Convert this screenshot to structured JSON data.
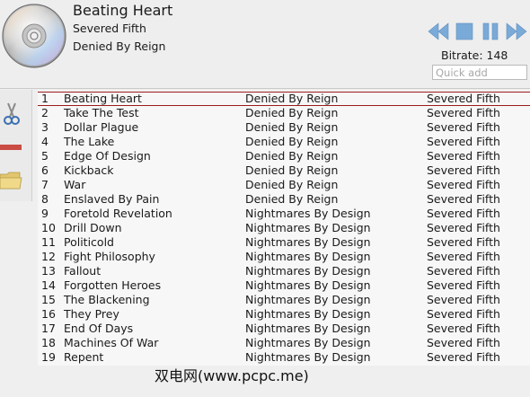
{
  "now_playing": {
    "title": "Beating Heart",
    "artist": "Severed Fifth",
    "album": "Denied By Reign"
  },
  "controls": {
    "prev_icon": "previous-track-icon",
    "stop_icon": "stop-icon",
    "pause_icon": "pause-icon",
    "next_icon": "next-track-icon",
    "icon_color": "#7aaad8"
  },
  "bitrate_text": "Bitrate: 148",
  "quick_add": {
    "placeholder": "Quick add",
    "value": ""
  },
  "side_tools": [
    "cut-icon",
    "remove-icon",
    "open-folder-icon"
  ],
  "playlist": {
    "selected_index": 0,
    "tracks": [
      {
        "num": "1",
        "title": "Beating Heart",
        "album": "Denied By Reign",
        "artist": "Severed Fifth"
      },
      {
        "num": "2",
        "title": "Take The Test",
        "album": "Denied By Reign",
        "artist": "Severed Fifth"
      },
      {
        "num": "3",
        "title": "Dollar Plague",
        "album": "Denied By Reign",
        "artist": "Severed Fifth"
      },
      {
        "num": "4",
        "title": "The Lake",
        "album": "Denied By Reign",
        "artist": "Severed Fifth"
      },
      {
        "num": "5",
        "title": "Edge Of Design",
        "album": "Denied By Reign",
        "artist": "Severed Fifth"
      },
      {
        "num": "6",
        "title": "Kickback",
        "album": "Denied By Reign",
        "artist": "Severed Fifth"
      },
      {
        "num": "7",
        "title": "War",
        "album": "Denied By Reign",
        "artist": "Severed Fifth"
      },
      {
        "num": "8",
        "title": "Enslaved By Pain",
        "album": "Denied By Reign",
        "artist": "Severed Fifth"
      },
      {
        "num": "9",
        "title": "Foretold Revelation",
        "album": "Nightmares By Design",
        "artist": "Severed Fifth"
      },
      {
        "num": "10",
        "title": "Drill Down",
        "album": "Nightmares By Design",
        "artist": "Severed Fifth"
      },
      {
        "num": "11",
        "title": "Politicold",
        "album": "Nightmares By Design",
        "artist": "Severed Fifth"
      },
      {
        "num": "12",
        "title": "Fight Philosophy",
        "album": "Nightmares By Design",
        "artist": "Severed Fifth"
      },
      {
        "num": "13",
        "title": "Fallout",
        "album": "Nightmares By Design",
        "artist": "Severed Fifth"
      },
      {
        "num": "14",
        "title": "Forgotten Heroes",
        "album": "Nightmares By Design",
        "artist": "Severed Fifth"
      },
      {
        "num": "15",
        "title": "The Blackening",
        "album": "Nightmares By Design",
        "artist": "Severed Fifth"
      },
      {
        "num": "16",
        "title": "They Prey",
        "album": "Nightmares By Design",
        "artist": "Severed Fifth"
      },
      {
        "num": "17",
        "title": "End Of Days",
        "album": "Nightmares By Design",
        "artist": "Severed Fifth"
      },
      {
        "num": "18",
        "title": "Machines Of War",
        "album": "Nightmares By Design",
        "artist": "Severed Fifth"
      },
      {
        "num": "19",
        "title": "Repent",
        "album": "Nightmares By Design",
        "artist": "Severed Fifth"
      }
    ]
  },
  "watermark": "双电网(www.pcpc.me)"
}
